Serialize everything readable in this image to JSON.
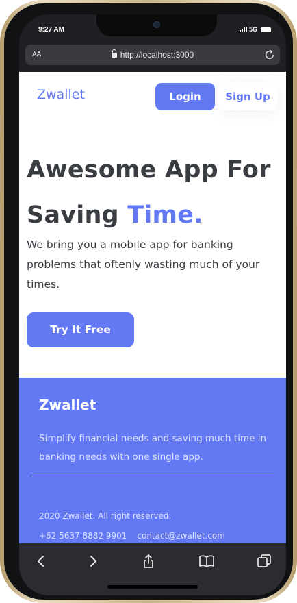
{
  "status_bar": {
    "time": "9:27 AM",
    "network": "5G"
  },
  "browser": {
    "text_size_label": "AA",
    "url": "http://localhost:3000"
  },
  "navbar": {
    "brand": "Zwallet",
    "login_label": "Login",
    "signup_label": "Sign Up"
  },
  "hero": {
    "title_line1": "Awesome App For",
    "title_line2_prefix": "Saving ",
    "title_line2_accent": "Time.",
    "description": "We bring you a mobile app for banking problems that oftenly wasting much of your times.",
    "cta_label": "Try It Free"
  },
  "footer": {
    "brand": "Zwallet",
    "description": "Simplify financial needs and saving much time in banking needs with one single app.",
    "copyright": "2020 Zwallet. All right reserved.",
    "phone": "+62 5637 8882 9901",
    "email": "contact@zwallet.com"
  },
  "toolbar": {
    "icons": [
      "back-icon",
      "forward-icon",
      "share-icon",
      "bookmarks-icon",
      "tabs-icon"
    ]
  },
  "colors": {
    "accent": "#6379f4",
    "text_dark": "#3a3d42",
    "browser_chrome": "#2b2c30",
    "phone_frame": "#cdb98e"
  }
}
